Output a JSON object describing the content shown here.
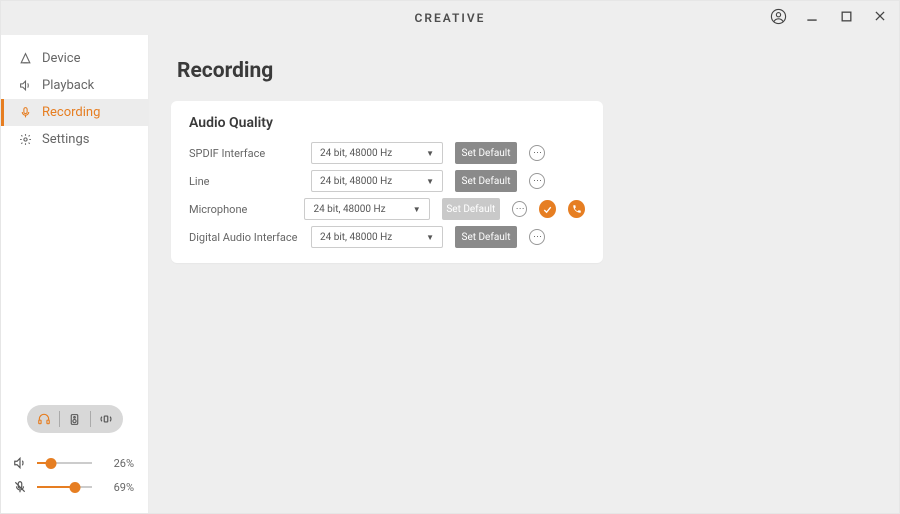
{
  "brand": "CREATIVE",
  "sidebar": {
    "items": [
      {
        "label": "Device"
      },
      {
        "label": "Playback"
      },
      {
        "label": "Recording"
      },
      {
        "label": "Settings"
      }
    ]
  },
  "volume": {
    "output_pct": "26%",
    "output_val": 26,
    "mic_pct": "69%",
    "mic_val": 69
  },
  "page": {
    "title": "Recording",
    "card_title": "Audio Quality",
    "rows": [
      {
        "label": "SPDIF Interface",
        "value": "24 bit, 48000 Hz",
        "button": "Set Default",
        "disabled": false,
        "badges": []
      },
      {
        "label": "Line",
        "value": "24 bit, 48000 Hz",
        "button": "Set Default",
        "disabled": false,
        "badges": []
      },
      {
        "label": "Microphone",
        "value": "24 bit, 48000 Hz",
        "button": "Set Default",
        "disabled": true,
        "badges": [
          "check",
          "phone"
        ]
      },
      {
        "label": "Digital Audio Interface",
        "value": "24 bit, 48000 Hz",
        "button": "Set Default",
        "disabled": false,
        "badges": []
      }
    ]
  }
}
